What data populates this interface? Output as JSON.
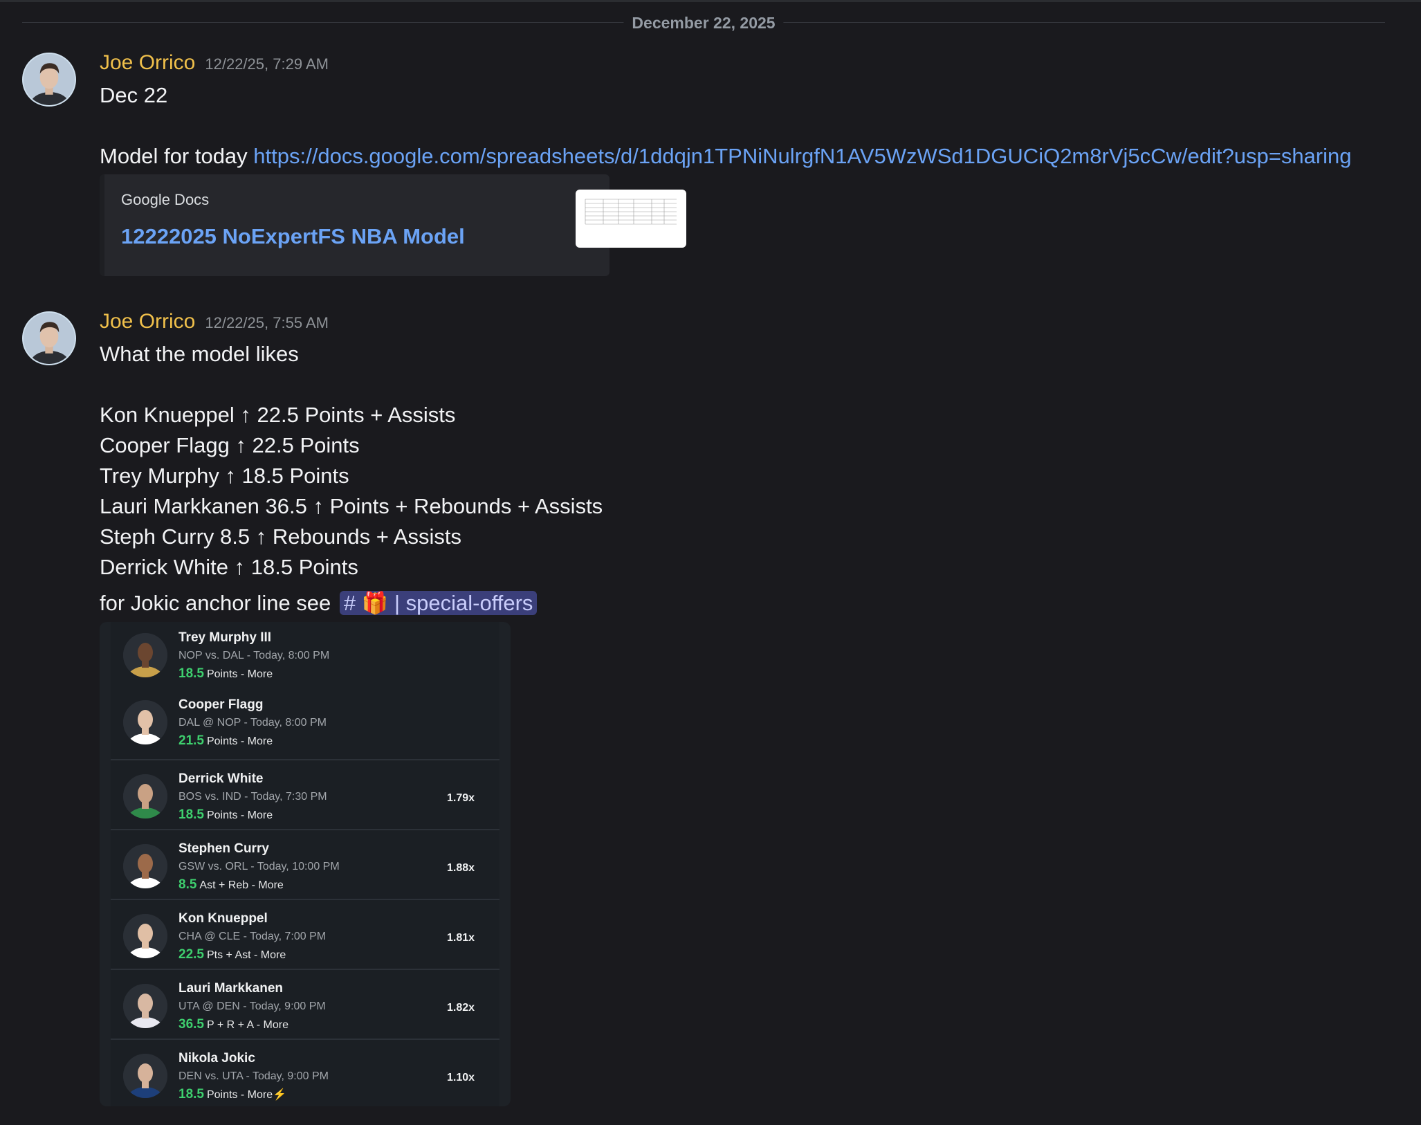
{
  "divider_date": "December 22, 2025",
  "messages": [
    {
      "author": "Joe Orrico",
      "timestamp": "12/22/25, 7:29 AM",
      "line1": "Dec 22",
      "line2_prefix": "Model for today ",
      "line2_link": "https://docs.google.com/spreadsheets/d/1ddqjn1TPNiNulrgfN1AV5WzWSd1DGUCiQ2m8rVj5cCw/edit?usp=sharing",
      "embed": {
        "provider": "Google Docs",
        "title": "12222025 NoExpertFS NBA Model"
      }
    },
    {
      "author": "Joe Orrico",
      "timestamp": "12/22/25, 7:55 AM",
      "intro": "What the model likes",
      "picks": [
        "Kon Knueppel ↑ 22.5 Points + Assists",
        "Cooper Flagg ↑ 22.5 Points",
        "Trey Murphy ↑ 18.5 Points",
        "Lauri Markkanen 36.5 ↑ Points + Rebounds + Assists",
        "Steph Curry 8.5 ↑ Rebounds + Assists",
        "Derrick White ↑ 18.5 Points"
      ],
      "jokic_prefix": "for Jokic anchor line see ",
      "channel": "# 🎁 | special-offers"
    }
  ],
  "card": {
    "rows": [
      {
        "name": "Trey Murphy III",
        "game": "NOP vs. DAL - Today, 8:00 PM",
        "value": "18.5",
        "stat": "Points - More",
        "mult": "",
        "jersey": "#c8a04a",
        "skin": "#6b4630"
      },
      {
        "name": "Cooper Flagg",
        "game": "DAL @ NOP - Today, 8:00 PM",
        "value": "21.5",
        "stat": "Points - More",
        "mult": "",
        "jersey": "#ffffff",
        "skin": "#e2c1a8"
      },
      {
        "name": "Derrick White",
        "game": "BOS vs. IND - Today, 7:30 PM",
        "value": "18.5",
        "stat": "Points - More",
        "mult": "1.79x",
        "jersey": "#2f8a4a",
        "skin": "#c9a184"
      },
      {
        "name": "Stephen Curry",
        "game": "GSW vs. ORL - Today, 10:00 PM",
        "value": "8.5",
        "stat": "Ast + Reb - More",
        "mult": "1.88x",
        "jersey": "#ffffff",
        "skin": "#9c6a4a"
      },
      {
        "name": "Kon Knueppel",
        "game": "CHA @ CLE - Today, 7:00 PM",
        "value": "22.5",
        "stat": "Pts + Ast - More",
        "mult": "1.81x",
        "jersey": "#ffffff",
        "skin": "#e0bfa5"
      },
      {
        "name": "Lauri Markkanen",
        "game": "UTA @ DEN - Today, 9:00 PM",
        "value": "36.5",
        "stat": "P + R + A - More",
        "mult": "1.82x",
        "jersey": "#e8e8f0",
        "skin": "#d8b8a2"
      },
      {
        "name": "Nikola Jokic",
        "game": "DEN vs. UTA - Today, 9:00 PM",
        "value": "18.5",
        "stat": "Points - More⚡",
        "mult": "1.10x",
        "jersey": "#1d3f7a",
        "skin": "#d6b29a"
      }
    ]
  }
}
